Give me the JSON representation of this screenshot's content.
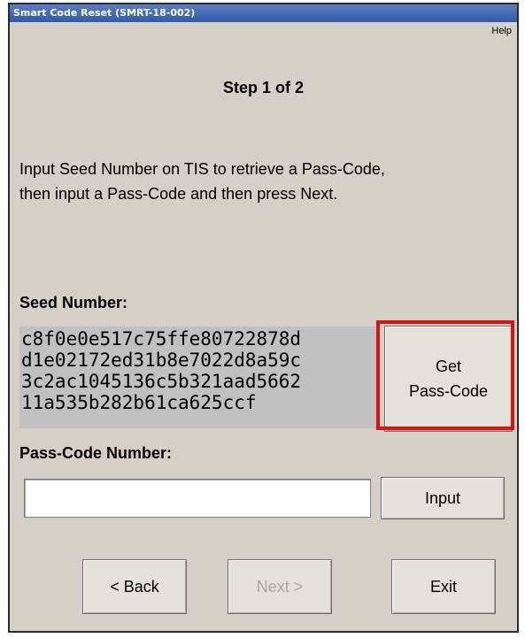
{
  "window": {
    "title": "Smart Code Reset (SMRT-18-002)"
  },
  "menu": {
    "help_label": "Help"
  },
  "step": {
    "title": "Step 1 of 2"
  },
  "instructions": {
    "line1": "Input Seed Number on TIS to retrieve a Pass-Code,",
    "line2": "then input a Pass-Code and then press Next."
  },
  "seed": {
    "label": "Seed Number:",
    "lines": [
      "c8f0e0e517c75ffe80722878d",
      "d1e02172ed31b8e7022d8a59c",
      "3c2ac1045136c5b321aad5662",
      "11a535b282b61ca625ccf"
    ]
  },
  "get_passcode_button": {
    "line1": "Get",
    "line2": "Pass-Code"
  },
  "passcode": {
    "label": "Pass-Code Number:",
    "value": "",
    "placeholder": ""
  },
  "input_button": {
    "label": "Input"
  },
  "navigation": {
    "back_label": "< Back",
    "next_label": "Next >",
    "next_enabled": false,
    "exit_label": "Exit"
  },
  "colors": {
    "dialog_background": "#d4d0c8",
    "title_bar": "#2f5aa7",
    "highlight_border": "#e01010",
    "seed_background": "#c0c0c0",
    "disabled_text": "#a6a6a6"
  }
}
